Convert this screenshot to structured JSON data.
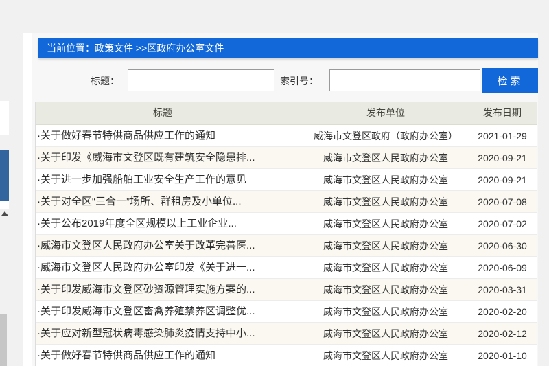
{
  "breadcrumb": {
    "text": "当前位置：政策文件 >>区政府办公室文件"
  },
  "search": {
    "title_label": "标题：",
    "title_value": "",
    "index_label": "索引号：",
    "index_value": "",
    "button_label": "检索"
  },
  "table": {
    "bullet": "·",
    "headers": {
      "title": "标题",
      "publisher": "发布单位",
      "date": "发布日期"
    },
    "rows": [
      {
        "title": "关于做好春节特供商品供应工作的通知",
        "publisher": "威海市文登区政府（政府办公室）",
        "date": "2021-01-29"
      },
      {
        "title": "关于印发《威海市文登区既有建筑安全隐患排...",
        "publisher": "威海市文登区人民政府办公室",
        "date": "2020-09-21"
      },
      {
        "title": "关于进一步加强船舶工业安全生产工作的意见",
        "publisher": "威海市文登区人民政府办公室",
        "date": "2020-09-21"
      },
      {
        "title": "关于对全区“三合一”场所、群租房及小单位...",
        "publisher": "威海市文登区人民政府办公室",
        "date": "2020-07-08"
      },
      {
        "title": "关于公布2019年度全区规模以上工业企业...",
        "publisher": "威海市文登区人民政府办公室",
        "date": "2020-07-02"
      },
      {
        "title": "威海市文登区人民政府办公室关于改革完善医...",
        "publisher": "威海市文登区人民政府办公室",
        "date": "2020-06-30"
      },
      {
        "title": "威海市文登区人民政府办公室印发《关于进一...",
        "publisher": "威海市文登区人民政府办公室",
        "date": "2020-06-09"
      },
      {
        "title": "关于印发威海市文登区砂资源管理实施方案的...",
        "publisher": "威海市文登区人民政府办公室",
        "date": "2020-03-31"
      },
      {
        "title": "关于印发威海市文登区畜禽养殖禁养区调整优...",
        "publisher": "威海市文登区人民政府办公室",
        "date": "2020-02-20"
      },
      {
        "title": "关于应对新型冠状病毒感染肺炎疫情支持中小...",
        "publisher": "威海市文登区人民政府办公室",
        "date": "2020-02-12"
      },
      {
        "title": "关于做好春节特供商品供应工作的通知",
        "publisher": "威海市文登区人民政府办公室",
        "date": "2020-01-10"
      }
    ]
  },
  "colors": {
    "accent_blue": "#1268d8",
    "fragment_blue": "#32659e",
    "header_bg": "#e9eae1",
    "alt_row_bg": "#faf8f1",
    "page_bg": "#f1f1f1"
  }
}
